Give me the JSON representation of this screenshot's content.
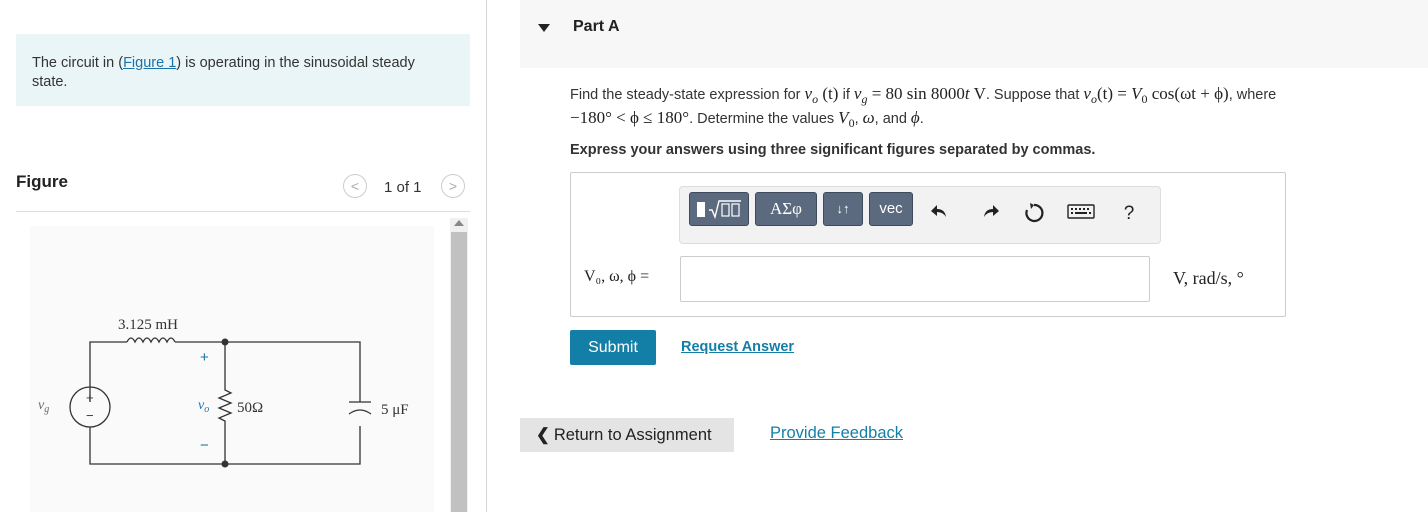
{
  "intro": {
    "text_before": "The circuit in (",
    "figure_link": "Figure 1",
    "text_after": ") is operating in the sinusoidal steady state."
  },
  "figure": {
    "title": "Figure",
    "pager": "1 of 1",
    "prev_icon": "chevron-left-icon",
    "next_icon": "chevron-right-icon",
    "circuit": {
      "inductor_label": "3.125 mH",
      "source_label": "v",
      "source_subscript": "g",
      "output_label": "v",
      "output_subscript": "o",
      "resistor_label": "50Ω",
      "capacitor_label": "5 μF",
      "plus": "+",
      "minus": "−"
    }
  },
  "part": {
    "title": "Part A",
    "question_line1": {
      "t1": "Find the steady-state expression for ",
      "m_vo": "v",
      "m_vo_sub": "o",
      "m_t": " (t) ",
      "t2": "if ",
      "m_vg": "v",
      "m_vg_sub": "g",
      "m_eq": " = 80 sin 8000",
      "m_t2": "t",
      "m_V": " V",
      "t3": ". Suppose that ",
      "m_expr": "v",
      "m_expr_sub": "o",
      "m_expr_rest": "(t) = ",
      "m_V0": "V",
      "m_V0_sub": "0",
      "m_cos": " cos(ωt + ϕ)",
      "t4": ", where"
    },
    "question_line2": {
      "m_range": "−180° < ϕ ≤ 180°",
      "t1": ". Determine the values ",
      "m_vals": "V",
      "m_vals_sub": "0",
      "t2": ", ",
      "m_omega": "ω",
      "t3": ", and ",
      "m_phi": "ϕ",
      "t4": "."
    },
    "instruction": "Express your answers using three significant figures separated by commas.",
    "toolbar": {
      "templates_icon": "fraction-radical-template-icon",
      "greek_label": "ΑΣφ",
      "updown_label": "↓↑",
      "vec_label": "vec",
      "undo_icon": "undo-icon",
      "redo_icon": "redo-icon",
      "reset_icon": "reset-icon",
      "keyboard_icon": "keyboard-icon",
      "help_label": "?"
    },
    "answer": {
      "var_label": "V₀, ω, ϕ =",
      "value": "",
      "units": "V, rad/s, °"
    },
    "submit_label": "Submit",
    "request_answer_label": "Request Answer"
  },
  "footer": {
    "return_label": "Return to Assignment",
    "feedback_label": "Provide Feedback"
  },
  "colors": {
    "intro_bg": "#e9f5f7",
    "link": "#137fa6",
    "submit_bg": "#137fa6",
    "toolbar_btn": "#5b6a7e",
    "return_bg": "#e4e4e4"
  }
}
